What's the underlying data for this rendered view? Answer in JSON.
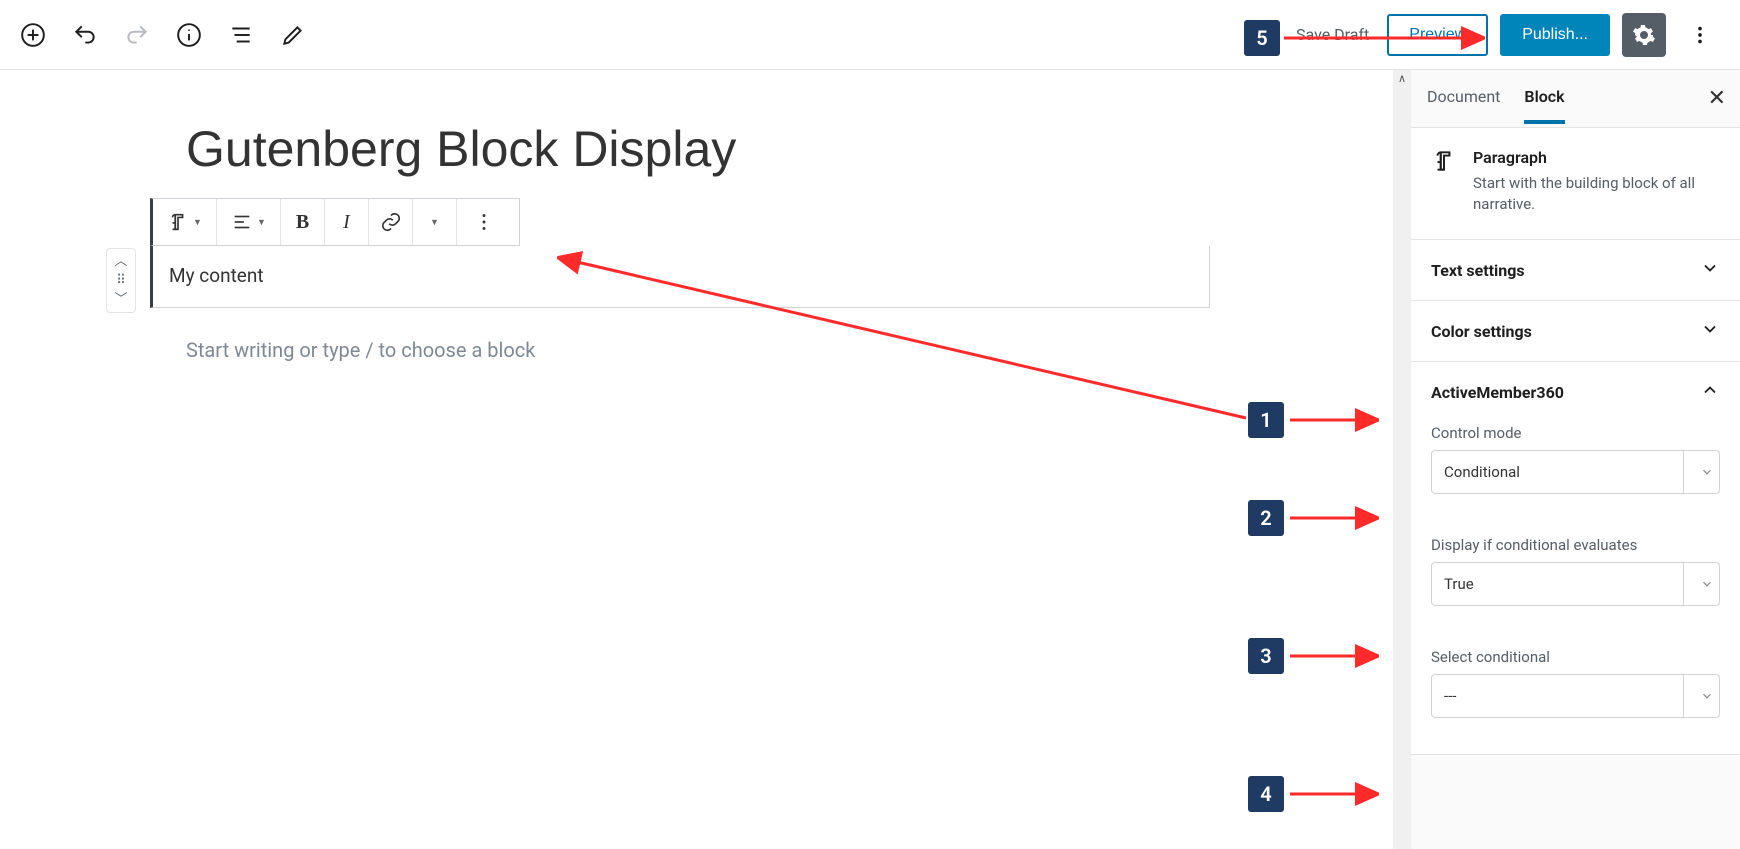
{
  "toolbar": {
    "save_draft": "Save Draft",
    "preview": "Preview",
    "publish": "Publish..."
  },
  "editor": {
    "title": "Gutenberg Block Display",
    "content": "My content",
    "placeholder": "Start writing or type / to choose a block"
  },
  "sidebar": {
    "tab_document": "Document",
    "tab_block": "Block",
    "block_name": "Paragraph",
    "block_desc": "Start with the building block of all narrative.",
    "panels": {
      "text_settings": "Text settings",
      "color_settings": "Color settings",
      "active_member": "ActiveMember360"
    },
    "fields": {
      "control_mode_label": "Control mode",
      "control_mode_value": "Conditional",
      "display_if_label": "Display if conditional evaluates",
      "display_if_value": "True",
      "select_cond_label": "Select conditional",
      "select_cond_value": "---"
    }
  },
  "markers": {
    "m1": "1",
    "m2": "2",
    "m3": "3",
    "m4": "4",
    "m5": "5"
  },
  "colors": {
    "marker_bg": "#1f3b63",
    "arrow": "#ff2a2a",
    "primary_blue": "#0073aa",
    "publish_blue": "#0085ba"
  }
}
